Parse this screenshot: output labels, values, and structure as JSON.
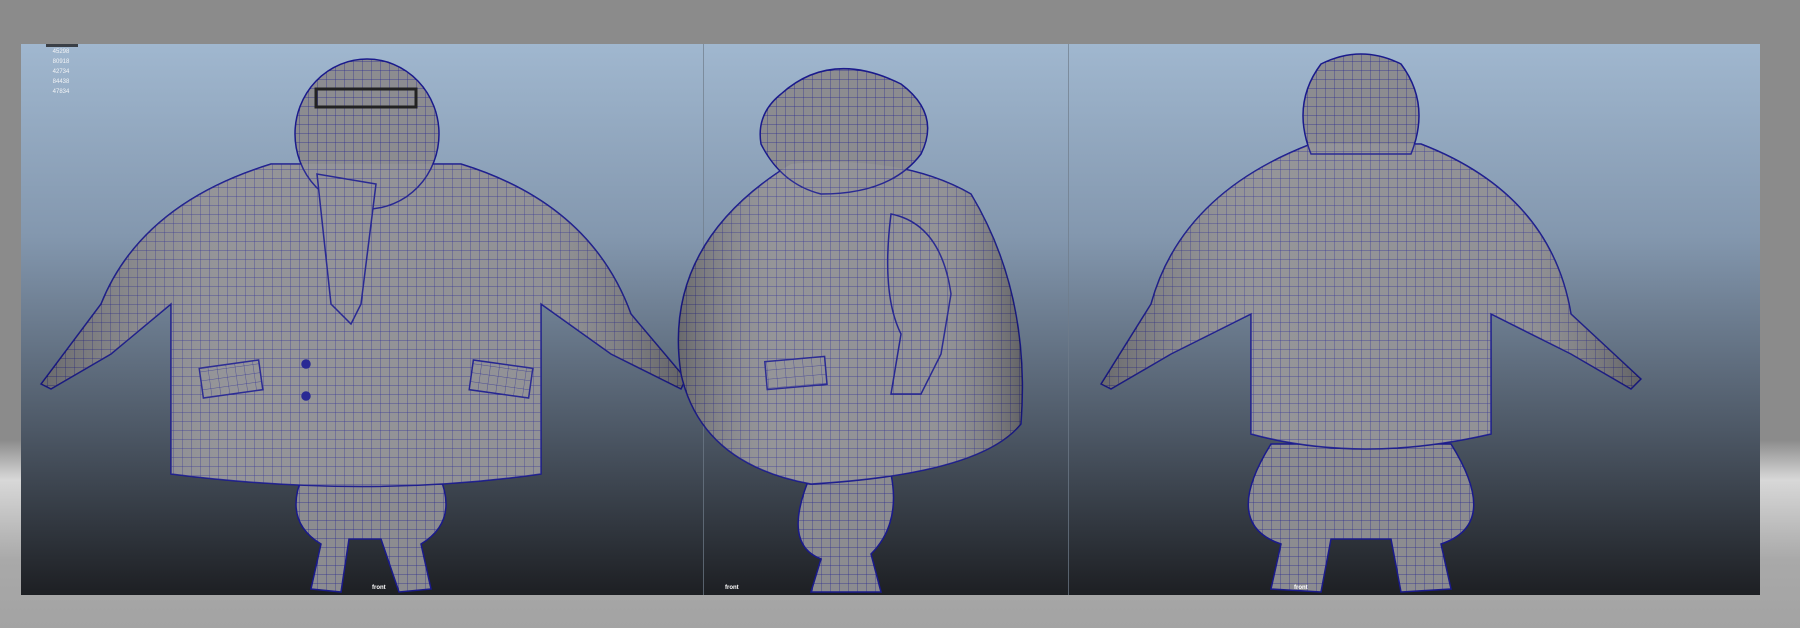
{
  "viewport": {
    "poly_stats": [
      "45298",
      "80918",
      "42734",
      "84438",
      "47834"
    ],
    "camera_labels": [
      "front",
      "front",
      "front"
    ]
  },
  "colors": {
    "wireframe": "#1a1a8c",
    "mesh": "#8a8a8e"
  }
}
